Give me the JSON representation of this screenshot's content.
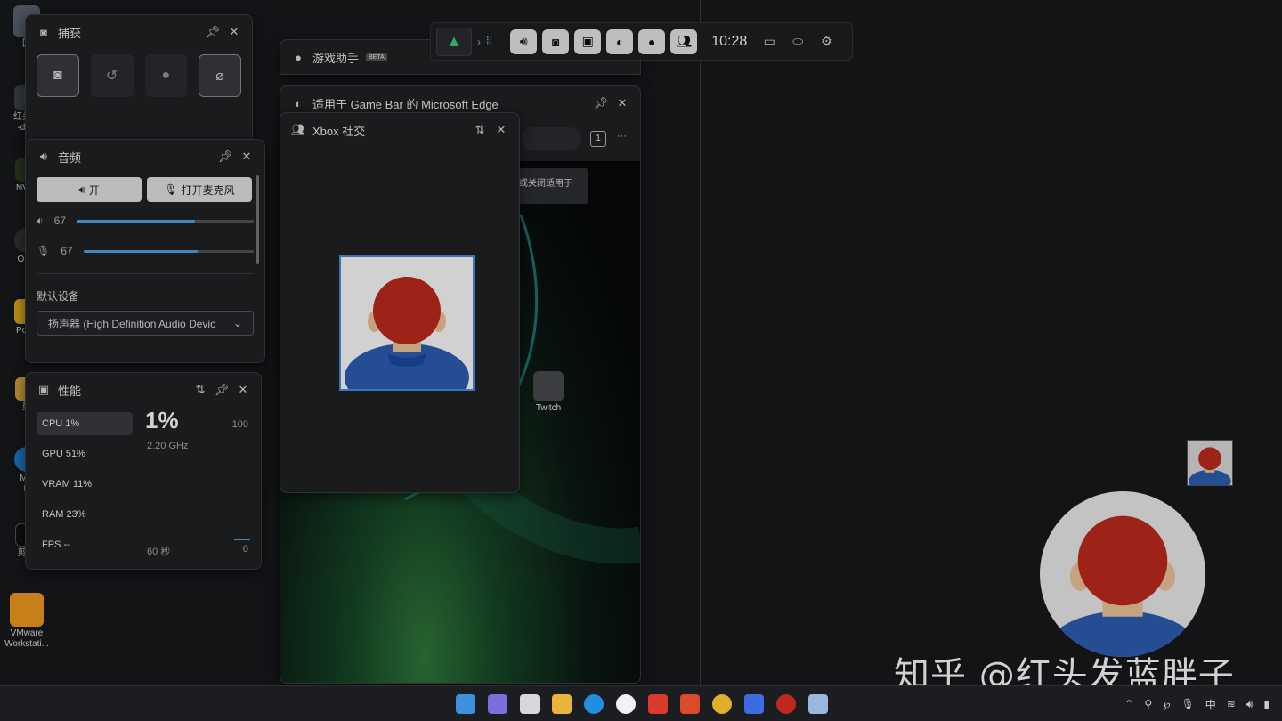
{
  "desktop_icons": [
    {
      "label": "回"
    },
    {
      "label": "红头发\n-disk"
    },
    {
      "label": "NVID"
    },
    {
      "label": "OBS"
    },
    {
      "label": "PotPl\nL"
    },
    {
      "label": "剪"
    },
    {
      "label": "Mic\nE"
    },
    {
      "label": "剪映"
    },
    {
      "label": "VMware\nWorkstati..."
    }
  ],
  "gamebar": {
    "time": "10:28"
  },
  "capture": {
    "title": "捕获"
  },
  "audio": {
    "title": "音频",
    "speaker_btn": "开",
    "mic_btn": "打开麦克风",
    "speaker_vol": "67",
    "mic_vol": "67",
    "speaker_level": 0.67,
    "mic_level": 0.67,
    "default_device_label": "默认设备",
    "device_value": "扬声器 (High Definition Audio Devic"
  },
  "perf": {
    "title": "性能",
    "items": [
      {
        "label": "CPU  1%"
      },
      {
        "label": "GPU  51%"
      },
      {
        "label": "VRAM  11%"
      },
      {
        "label": "RAM  23%"
      },
      {
        "label": "FPS  --"
      }
    ],
    "big_value": "1%",
    "sub_value": "2.20 GHz",
    "max_label": "100",
    "time_label": "60 秒",
    "min_label": "0"
  },
  "assistant": {
    "title": "游戏助手",
    "badge": "BETA"
  },
  "edge": {
    "title": "适用于 Game Bar 的 Microsoft Edge",
    "tab_count": "1",
    "more": "···",
    "popup_text": "或关闭适用于",
    "tile_label": "Twitch"
  },
  "xbox": {
    "title": "Xbox 社交"
  },
  "watermark": "知乎 @红头发蓝胖子",
  "tray": {
    "ime": "中"
  },
  "colors": {
    "accent": "#4aa9e9",
    "panel": "#202124"
  }
}
